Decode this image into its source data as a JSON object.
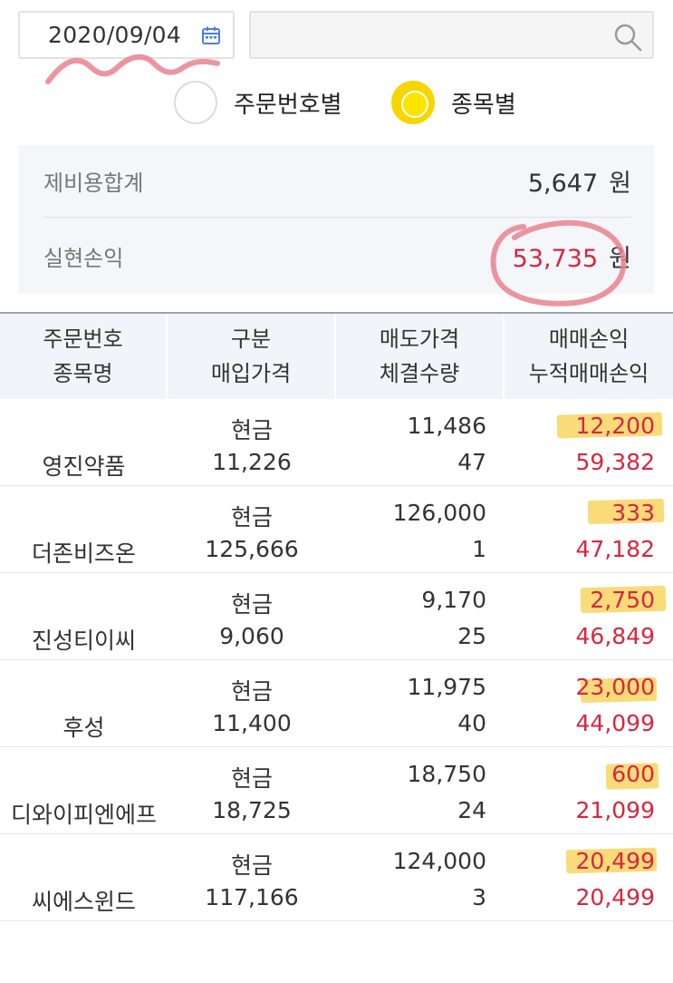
{
  "filter": {
    "date": "2020/09/04",
    "search_value": ""
  },
  "view_mode": {
    "options": [
      "주문번호별",
      "종목별"
    ],
    "selected": "종목별"
  },
  "summary": {
    "fee_label": "제비용합계",
    "fee_value": "5,647",
    "pnl_label": "실현손익",
    "pnl_value": "53,735",
    "unit": "원"
  },
  "table": {
    "headers": [
      [
        "주문번호",
        "종목명"
      ],
      [
        "구분",
        "매입가격"
      ],
      [
        "매도가격",
        "체결수량"
      ],
      [
        "매매손익",
        "누적매매손익"
      ]
    ],
    "rows": [
      {
        "name": "영진약품",
        "type": "현금",
        "buy_price": "11,226",
        "sell_price": "11,486",
        "qty": "47",
        "pnl": "12,200",
        "cum_pnl": "59,382"
      },
      {
        "name": "더존비즈온",
        "type": "현금",
        "buy_price": "125,666",
        "sell_price": "126,000",
        "qty": "1",
        "pnl": "333",
        "cum_pnl": "47,182"
      },
      {
        "name": "진성티이씨",
        "type": "현금",
        "buy_price": "9,060",
        "sell_price": "9,170",
        "qty": "25",
        "pnl": "2,750",
        "cum_pnl": "46,849"
      },
      {
        "name": "후성",
        "type": "현금",
        "buy_price": "11,400",
        "sell_price": "11,975",
        "qty": "40",
        "pnl": "23,000",
        "cum_pnl": "44,099"
      },
      {
        "name": "디와이피엔에프",
        "type": "현금",
        "buy_price": "18,725",
        "sell_price": "18,750",
        "qty": "24",
        "pnl": "600",
        "cum_pnl": "21,099"
      },
      {
        "name": "씨에스윈드",
        "type": "현금",
        "buy_price": "117,166",
        "sell_price": "124,000",
        "qty": "3",
        "pnl": "20,499",
        "cum_pnl": "20,499"
      }
    ]
  },
  "colors": {
    "accent_yellow": "#ffe400",
    "profit_red": "#d8263e",
    "highlight": "#f7cd46",
    "annotation_pink": "#e8828f"
  },
  "icons": [
    "calendar-icon",
    "search-icon"
  ]
}
